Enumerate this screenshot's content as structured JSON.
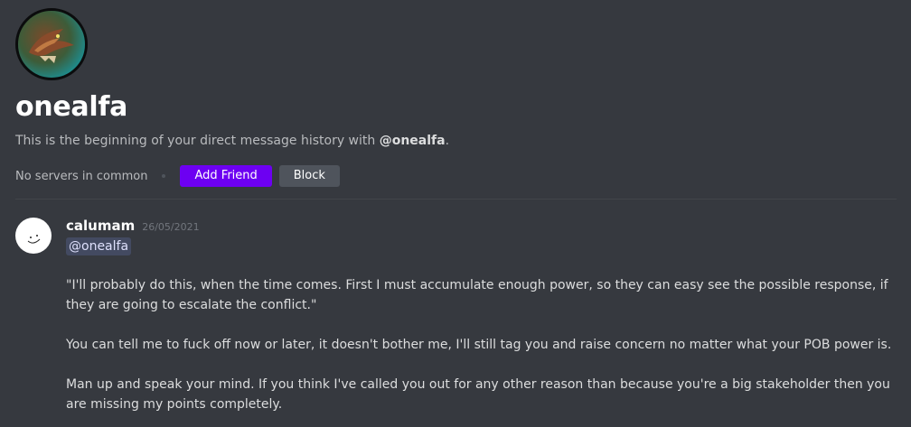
{
  "profile": {
    "username": "onealfa",
    "history_prefix": "This is the beginning of your direct message history with ",
    "history_mention": "@onealfa",
    "history_suffix": ".",
    "no_servers": "No servers in common",
    "add_friend_label": "Add Friend",
    "block_label": "Block",
    "avatar_icon": "dragon-avatar"
  },
  "message": {
    "author": "calumam",
    "timestamp": "26/05/2021",
    "avatar_icon": "smiley-avatar",
    "mention": "@onealfa",
    "paragraphs": [
      "\"I'll probably do this, when the time comes. First I must accumulate enough power, so they can easy see the possible response, if they are going to escalate the conflict.\"",
      "You can tell me to fuck off now or later, it doesn't bother me, I'll still tag you and raise concern no matter what your POB power is.",
      "Man up and speak your mind. If you think I've called you out for any other reason than because you're a big stakeholder then you are missing my points completely."
    ]
  },
  "colors": {
    "background": "#36393f",
    "add_friend": "#6d00f2",
    "block": "#4f545c",
    "mention_bg": "#4b4f8f"
  }
}
